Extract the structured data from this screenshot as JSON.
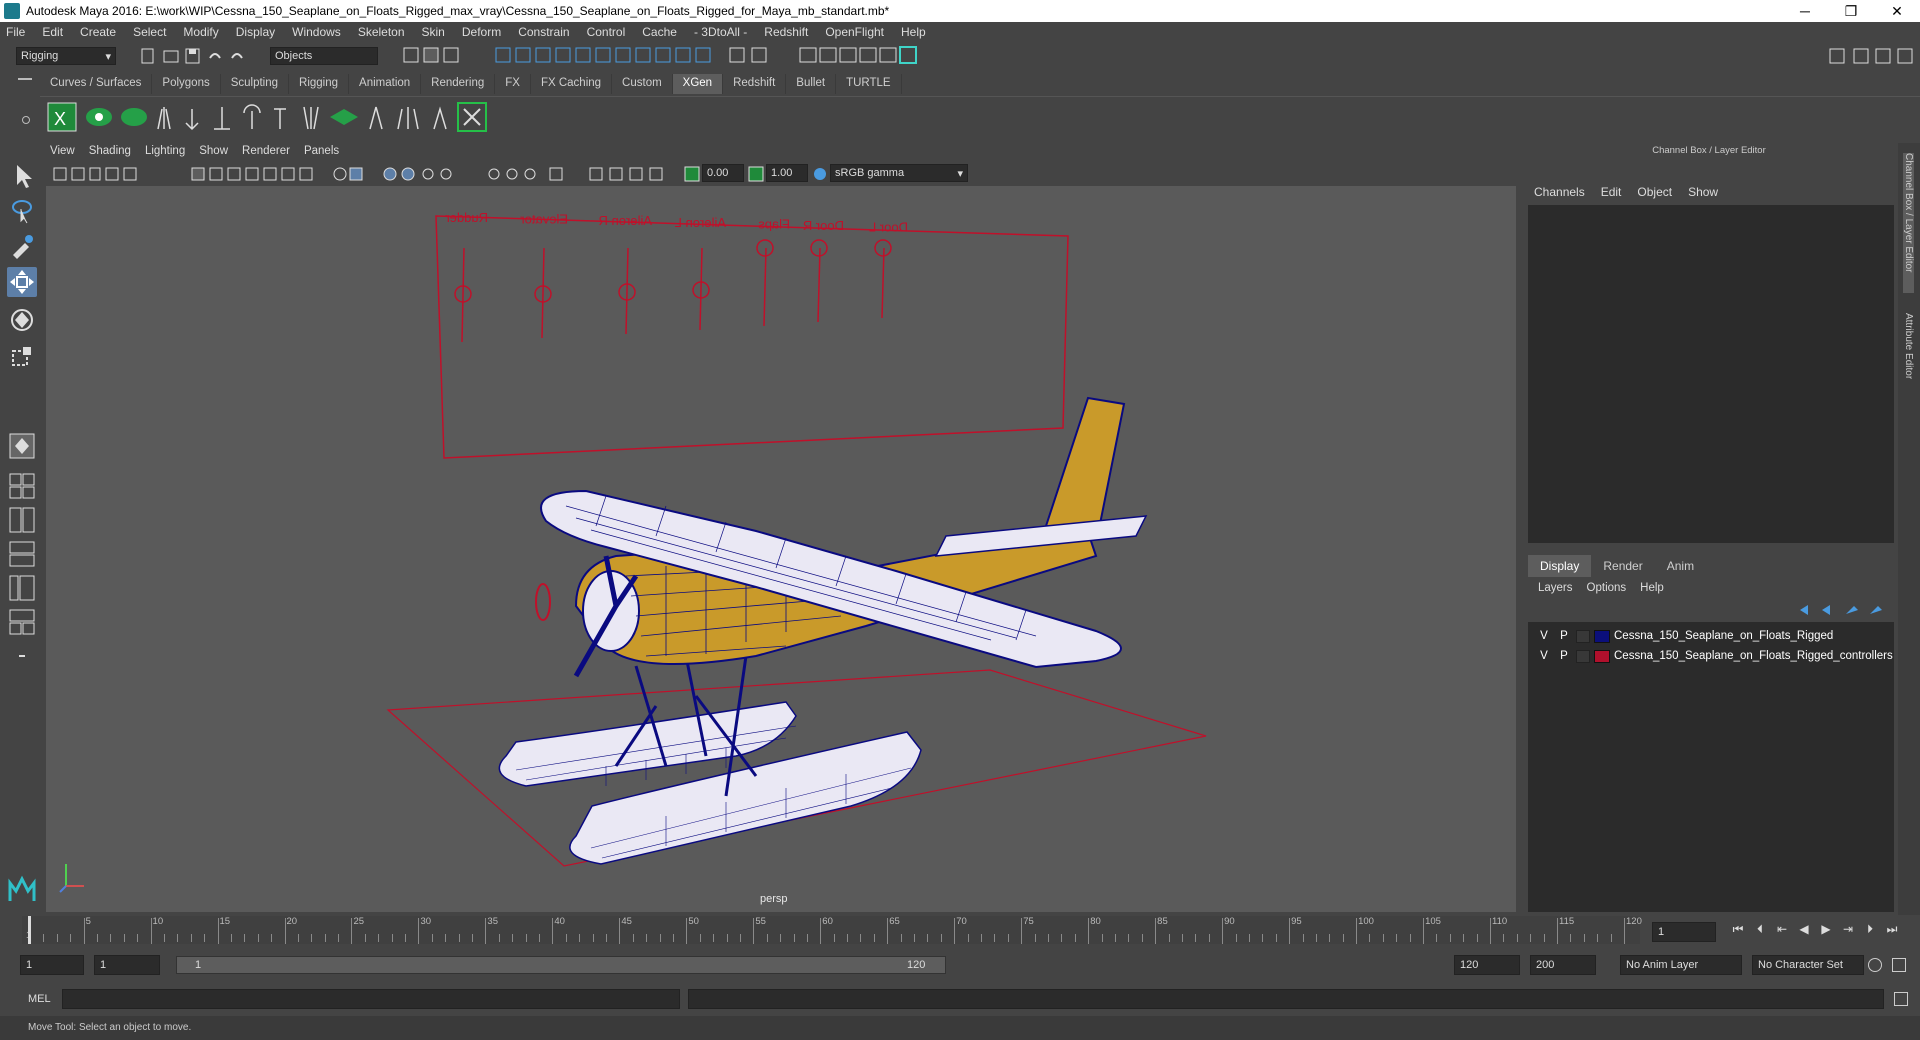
{
  "window": {
    "title": "Autodesk Maya 2016: E:\\work\\WIP\\Cessna_150_Seaplane_on_Floats_Rigged_max_vray\\Cessna_150_Seaplane_on_Floats_Rigged_for_Maya_mb_standart.mb*",
    "min": "─",
    "max": "❐",
    "close": "✕"
  },
  "menubar": [
    "File",
    "Edit",
    "Create",
    "Select",
    "Modify",
    "Display",
    "Windows",
    "Skeleton",
    "Skin",
    "Deform",
    "Constrain",
    "Control",
    "Cache",
    "- 3DtoAll -",
    "Redshift",
    "OpenFlight",
    "Help"
  ],
  "statusline": {
    "mode": "Rigging",
    "select_mode": "Objects"
  },
  "shelf": {
    "tabs": [
      "Curves / Surfaces",
      "Polygons",
      "Sculpting",
      "Rigging",
      "Animation",
      "Rendering",
      "FX",
      "FX Caching",
      "Custom",
      "XGen",
      "Redshift",
      "Bullet",
      "TURTLE"
    ],
    "active": "XGen"
  },
  "viewport": {
    "menu": [
      "View",
      "Shading",
      "Lighting",
      "Show",
      "Renderer",
      "Panels"
    ],
    "exposure": "0.00",
    "gamma": "1.00",
    "colorspace": "sRGB gamma",
    "camera": "persp",
    "controller_labels": [
      "Rudder",
      "Elevator",
      "Aileron R",
      "Aileron L",
      "Flaps",
      "Door R",
      "Door L"
    ]
  },
  "channelbox": {
    "title": "Channel Box / Layer Editor",
    "menu": [
      "Channels",
      "Edit",
      "Object",
      "Show"
    ],
    "layer_tabs": [
      "Display",
      "Render",
      "Anim"
    ],
    "layer_menu": [
      "Layers",
      "Options",
      "Help"
    ],
    "layers": [
      {
        "v": "V",
        "p": "P",
        "name": "Cessna_150_Seaplane_on_Floats_Rigged",
        "color": "#0b0f7a"
      },
      {
        "v": "V",
        "p": "P",
        "name": "Cessna_150_Seaplane_on_Floats_Rigged_controllers",
        "color": "#b0102c"
      }
    ],
    "side_tabs": [
      "Channel Box / Layer Editor",
      "Attribute Editor"
    ]
  },
  "timeslider": {
    "ticks": [
      "5",
      "10",
      "15",
      "20",
      "25",
      "30",
      "35",
      "40",
      "45",
      "50",
      "55",
      "60",
      "65",
      "70",
      "75",
      "80",
      "85",
      "90",
      "95",
      "100",
      "105",
      "110",
      "115",
      "120"
    ],
    "start": "1",
    "current_frame": "1"
  },
  "range": {
    "start": "1",
    "inner_start": "1",
    "slider_start": "1",
    "slider_end": "120",
    "end": "120",
    "max": "200",
    "anim_layer": "No Anim Layer",
    "char_set": "No Character Set"
  },
  "cmdline": {
    "label": "MEL"
  },
  "helpline": {
    "text": "Move Tool: Select an object to move."
  },
  "colors": {
    "wire": "#0a0a80",
    "yellow": "#c99a2a",
    "controller": "#c0102a",
    "viewport_bg": "#5a5a5a"
  }
}
